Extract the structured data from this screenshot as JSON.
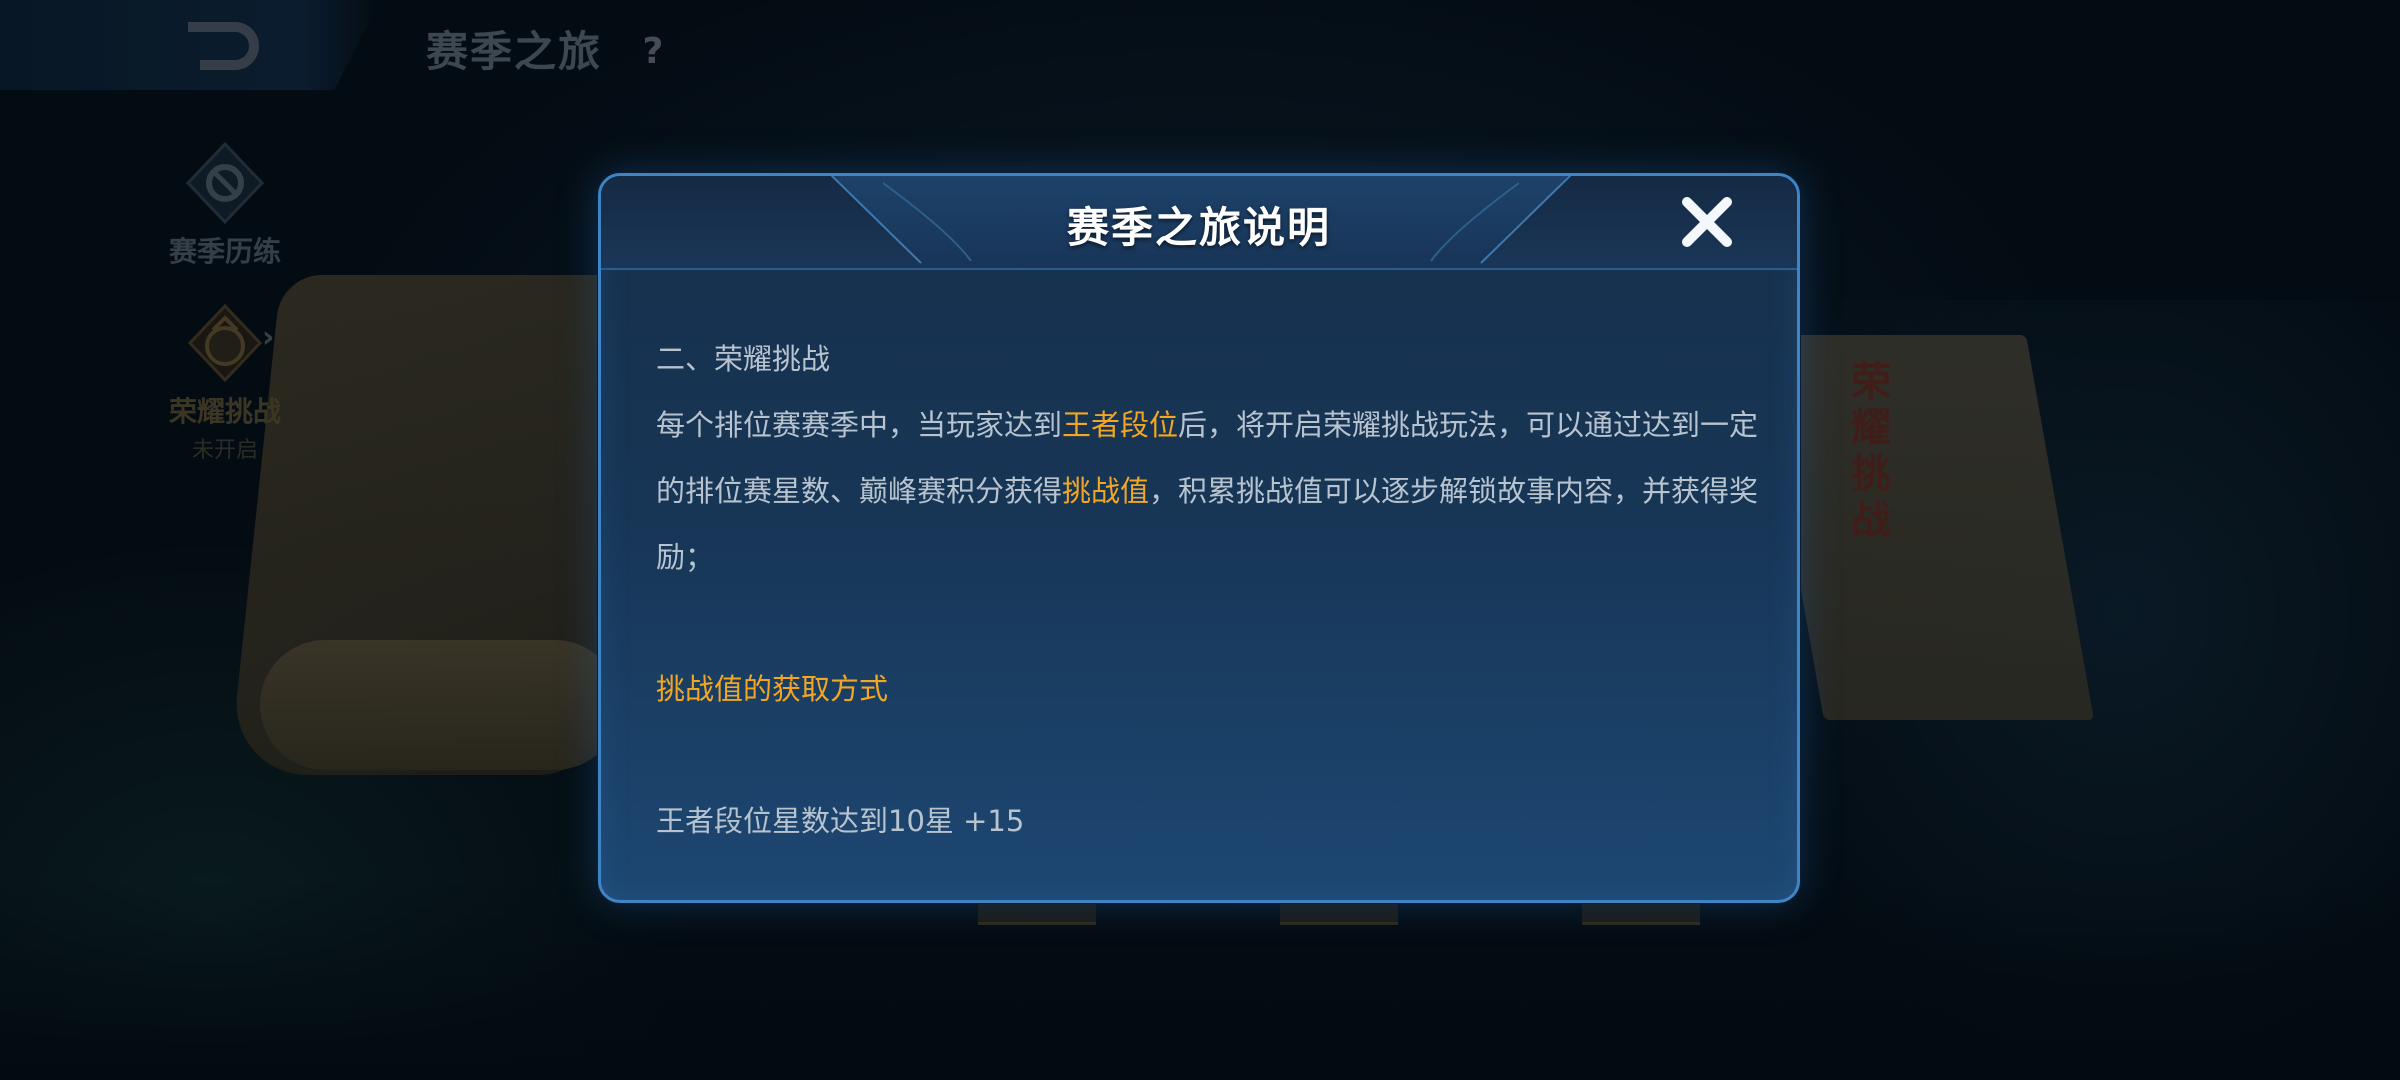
{
  "header": {
    "title": "赛季之旅",
    "help_label": "?"
  },
  "sidebar": {
    "items": [
      {
        "label": "赛季历练",
        "sub": ""
      },
      {
        "label": "荣耀挑战",
        "sub": "未开启"
      }
    ]
  },
  "background": {
    "book_text": "荣耀挑战"
  },
  "modal": {
    "title": "赛季之旅说明",
    "section_heading": "二、荣耀挑战",
    "para_1_pre": "每个排位赛赛季中，当玩家达到",
    "para_1_hl": "王者段位",
    "para_1_post": "后，将开启荣耀挑战玩法，可以通过达到一定",
    "para_2_pre": "的排位赛星数、巅峰赛积分获得",
    "para_2_hl": "挑战值",
    "para_2_post": "，积累挑战值可以逐步解锁故事内容，并获得奖",
    "para_3": "励；",
    "subheading": "挑战值的获取方式",
    "rule_1": "王者段位星数达到10星  +15"
  },
  "colors": {
    "highlight": "#f2a623",
    "body_text": "#b7c3cf",
    "modal_border": "#3f84c4"
  },
  "icons": {
    "back": "back-arrow-icon",
    "help": "question-mark-icon",
    "close": "close-icon"
  }
}
